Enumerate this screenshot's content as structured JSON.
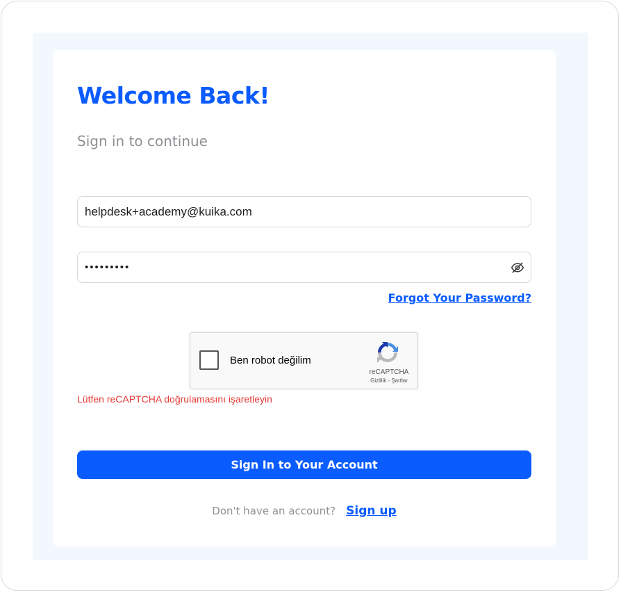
{
  "header": {
    "title": "Welcome Back!",
    "subtitle": "Sign in to continue"
  },
  "form": {
    "email_value": "helpdesk+academy@kuika.com",
    "password_value": "•••••••••",
    "password_toggle_icon": "eye-off-icon",
    "forgot_password_label": "Forgot Your Password?"
  },
  "recaptcha": {
    "checkbox_label": "Ben robot değilim",
    "brand": "reCAPTCHA",
    "terms": "Gizlilik - Şartlar",
    "logo_icon": "recaptcha-logo-icon",
    "error_message": "Lütfen reCAPTCHA doğrulamasını işaretleyin"
  },
  "actions": {
    "submit_label": "Sign In to Your Account",
    "signup_prompt": "Don't have an account?",
    "signup_label": "Sign up"
  },
  "colors": {
    "accent": "#0b5cff",
    "error": "#e53935",
    "muted_text": "#8e9094",
    "stage_background": "#f3f7fe"
  }
}
